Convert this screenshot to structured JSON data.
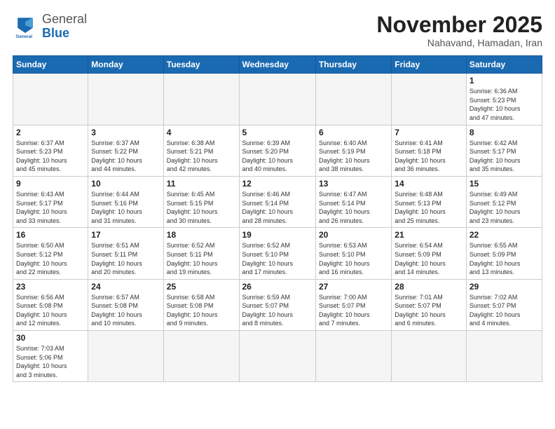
{
  "header": {
    "logo_general": "General",
    "logo_blue": "Blue",
    "month_title": "November 2025",
    "subtitle": "Nahavand, Hamadan, Iran"
  },
  "weekdays": [
    "Sunday",
    "Monday",
    "Tuesday",
    "Wednesday",
    "Thursday",
    "Friday",
    "Saturday"
  ],
  "weeks": [
    [
      {
        "day": "",
        "info": ""
      },
      {
        "day": "",
        "info": ""
      },
      {
        "day": "",
        "info": ""
      },
      {
        "day": "",
        "info": ""
      },
      {
        "day": "",
        "info": ""
      },
      {
        "day": "",
        "info": ""
      },
      {
        "day": "1",
        "info": "Sunrise: 6:36 AM\nSunset: 5:23 PM\nDaylight: 10 hours\nand 47 minutes."
      }
    ],
    [
      {
        "day": "2",
        "info": "Sunrise: 6:37 AM\nSunset: 5:23 PM\nDaylight: 10 hours\nand 45 minutes."
      },
      {
        "day": "3",
        "info": "Sunrise: 6:37 AM\nSunset: 5:22 PM\nDaylight: 10 hours\nand 44 minutes."
      },
      {
        "day": "4",
        "info": "Sunrise: 6:38 AM\nSunset: 5:21 PM\nDaylight: 10 hours\nand 42 minutes."
      },
      {
        "day": "5",
        "info": "Sunrise: 6:39 AM\nSunset: 5:20 PM\nDaylight: 10 hours\nand 40 minutes."
      },
      {
        "day": "6",
        "info": "Sunrise: 6:40 AM\nSunset: 5:19 PM\nDaylight: 10 hours\nand 38 minutes."
      },
      {
        "day": "7",
        "info": "Sunrise: 6:41 AM\nSunset: 5:18 PM\nDaylight: 10 hours\nand 36 minutes."
      },
      {
        "day": "8",
        "info": "Sunrise: 6:42 AM\nSunset: 5:17 PM\nDaylight: 10 hours\nand 35 minutes."
      }
    ],
    [
      {
        "day": "9",
        "info": "Sunrise: 6:43 AM\nSunset: 5:17 PM\nDaylight: 10 hours\nand 33 minutes."
      },
      {
        "day": "10",
        "info": "Sunrise: 6:44 AM\nSunset: 5:16 PM\nDaylight: 10 hours\nand 31 minutes."
      },
      {
        "day": "11",
        "info": "Sunrise: 6:45 AM\nSunset: 5:15 PM\nDaylight: 10 hours\nand 30 minutes."
      },
      {
        "day": "12",
        "info": "Sunrise: 6:46 AM\nSunset: 5:14 PM\nDaylight: 10 hours\nand 28 minutes."
      },
      {
        "day": "13",
        "info": "Sunrise: 6:47 AM\nSunset: 5:14 PM\nDaylight: 10 hours\nand 26 minutes."
      },
      {
        "day": "14",
        "info": "Sunrise: 6:48 AM\nSunset: 5:13 PM\nDaylight: 10 hours\nand 25 minutes."
      },
      {
        "day": "15",
        "info": "Sunrise: 6:49 AM\nSunset: 5:12 PM\nDaylight: 10 hours\nand 23 minutes."
      }
    ],
    [
      {
        "day": "16",
        "info": "Sunrise: 6:50 AM\nSunset: 5:12 PM\nDaylight: 10 hours\nand 22 minutes."
      },
      {
        "day": "17",
        "info": "Sunrise: 6:51 AM\nSunset: 5:11 PM\nDaylight: 10 hours\nand 20 minutes."
      },
      {
        "day": "18",
        "info": "Sunrise: 6:52 AM\nSunset: 5:11 PM\nDaylight: 10 hours\nand 19 minutes."
      },
      {
        "day": "19",
        "info": "Sunrise: 6:52 AM\nSunset: 5:10 PM\nDaylight: 10 hours\nand 17 minutes."
      },
      {
        "day": "20",
        "info": "Sunrise: 6:53 AM\nSunset: 5:10 PM\nDaylight: 10 hours\nand 16 minutes."
      },
      {
        "day": "21",
        "info": "Sunrise: 6:54 AM\nSunset: 5:09 PM\nDaylight: 10 hours\nand 14 minutes."
      },
      {
        "day": "22",
        "info": "Sunrise: 6:55 AM\nSunset: 5:09 PM\nDaylight: 10 hours\nand 13 minutes."
      }
    ],
    [
      {
        "day": "23",
        "info": "Sunrise: 6:56 AM\nSunset: 5:08 PM\nDaylight: 10 hours\nand 12 minutes."
      },
      {
        "day": "24",
        "info": "Sunrise: 6:57 AM\nSunset: 5:08 PM\nDaylight: 10 hours\nand 10 minutes."
      },
      {
        "day": "25",
        "info": "Sunrise: 6:58 AM\nSunset: 5:08 PM\nDaylight: 10 hours\nand 9 minutes."
      },
      {
        "day": "26",
        "info": "Sunrise: 6:59 AM\nSunset: 5:07 PM\nDaylight: 10 hours\nand 8 minutes."
      },
      {
        "day": "27",
        "info": "Sunrise: 7:00 AM\nSunset: 5:07 PM\nDaylight: 10 hours\nand 7 minutes."
      },
      {
        "day": "28",
        "info": "Sunrise: 7:01 AM\nSunset: 5:07 PM\nDaylight: 10 hours\nand 6 minutes."
      },
      {
        "day": "29",
        "info": "Sunrise: 7:02 AM\nSunset: 5:07 PM\nDaylight: 10 hours\nand 4 minutes."
      }
    ],
    [
      {
        "day": "30",
        "info": "Sunrise: 7:03 AM\nSunset: 5:06 PM\nDaylight: 10 hours\nand 3 minutes."
      },
      {
        "day": "",
        "info": ""
      },
      {
        "day": "",
        "info": ""
      },
      {
        "day": "",
        "info": ""
      },
      {
        "day": "",
        "info": ""
      },
      {
        "day": "",
        "info": ""
      },
      {
        "day": "",
        "info": ""
      }
    ]
  ]
}
